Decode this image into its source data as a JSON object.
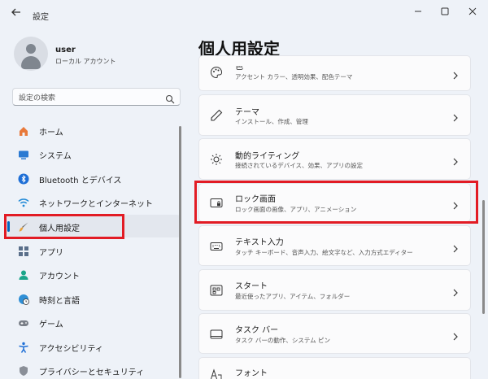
{
  "window": {
    "title": "設定"
  },
  "user": {
    "name": "user",
    "type": "ローカル アカウント"
  },
  "search": {
    "placeholder": "設定の検索"
  },
  "sidebar": {
    "items": [
      {
        "label": "ホーム",
        "icon": "home-icon"
      },
      {
        "label": "システム",
        "icon": "system-icon"
      },
      {
        "label": "Bluetooth とデバイス",
        "icon": "bluetooth-icon"
      },
      {
        "label": "ネットワークとインターネット",
        "icon": "wifi-icon"
      },
      {
        "label": "個人用設定",
        "icon": "brush-icon",
        "selected": true
      },
      {
        "label": "アプリ",
        "icon": "apps-icon"
      },
      {
        "label": "アカウント",
        "icon": "account-icon"
      },
      {
        "label": "時刻と言語",
        "icon": "globe-clock-icon"
      },
      {
        "label": "ゲーム",
        "icon": "gamepad-icon"
      },
      {
        "label": "アクセシビリティ",
        "icon": "accessibility-icon"
      },
      {
        "label": "プライバシーとセキュリティ",
        "icon": "shield-icon"
      }
    ]
  },
  "main": {
    "title": "個人用設定",
    "cards": [
      {
        "title": "色",
        "subtitle": "アクセント カラー、透明効果、配色テーマ",
        "icon": "palette-icon"
      },
      {
        "title": "テーマ",
        "subtitle": "インストール、作成、管理",
        "icon": "pen-icon"
      },
      {
        "title": "動的ライティング",
        "subtitle": "接続されているデバイス、効果、アプリの設定",
        "icon": "sun-icon"
      },
      {
        "title": "ロック画面",
        "subtitle": "ロック画面の画像、アプリ、アニメーション",
        "icon": "lock-screen-icon"
      },
      {
        "title": "テキスト入力",
        "subtitle": "タッチ キーボード、音声入力、絵文字など、入力方式エディター",
        "icon": "keyboard-icon"
      },
      {
        "title": "スタート",
        "subtitle": "最近使ったアプリ、アイテム、フォルダー",
        "icon": "start-icon"
      },
      {
        "title": "タスク バー",
        "subtitle": "タスク バーの動作、システム ピン",
        "icon": "taskbar-icon"
      },
      {
        "title": "フォント",
        "subtitle": "",
        "icon": "font-icon"
      }
    ]
  },
  "colors": {
    "accent": "#0067c0",
    "highlight": "#e21b24"
  }
}
